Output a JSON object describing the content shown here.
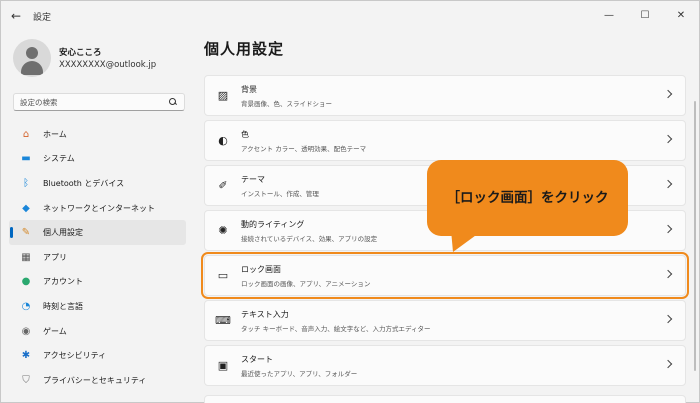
{
  "window": {
    "title": "設定",
    "back_glyph": "←",
    "minimize_glyph": "—",
    "maximize_glyph": "☐",
    "close_glyph": "✕"
  },
  "profile": {
    "name": "安心こころ",
    "email": "XXXXXXXX@outlook.jp"
  },
  "search": {
    "placeholder": "設定の検索"
  },
  "sidebar": {
    "items": [
      {
        "label": "ホーム",
        "icon": "home-icon",
        "glyph": "⌂",
        "color": "#d4622a"
      },
      {
        "label": "システム",
        "icon": "system-icon",
        "glyph": "▬",
        "color": "#1a86d9"
      },
      {
        "label": "Bluetooth とデバイス",
        "icon": "bluetooth-icon",
        "glyph": "ᛒ",
        "color": "#1a86d9"
      },
      {
        "label": "ネットワークとインターネット",
        "icon": "network-icon",
        "glyph": "◆",
        "color": "#1a86d9"
      },
      {
        "label": "個人用設定",
        "icon": "personalization-icon",
        "glyph": "✎",
        "color": "#d4892a"
      },
      {
        "label": "アプリ",
        "icon": "apps-icon",
        "glyph": "▦",
        "color": "#555555"
      },
      {
        "label": "アカウント",
        "icon": "account-icon",
        "glyph": "●",
        "color": "#2aa86f"
      },
      {
        "label": "時刻と言語",
        "icon": "time-language-icon",
        "glyph": "◔",
        "color": "#1a86d9"
      },
      {
        "label": "ゲーム",
        "icon": "gaming-icon",
        "glyph": "◉",
        "color": "#666666"
      },
      {
        "label": "アクセシビリティ",
        "icon": "accessibility-icon",
        "glyph": "✱",
        "color": "#1a6fc9"
      },
      {
        "label": "プライバシーとセキュリティ",
        "icon": "shield-icon",
        "glyph": "⛉",
        "color": "#777777"
      }
    ],
    "selected_index": 4,
    "accent": "#0067c0"
  },
  "main": {
    "title": "個人用設定",
    "cards": [
      {
        "title": "背景",
        "sub": "背景画像、色、スライドショー",
        "icon": "background-image-icon",
        "glyph": "▨"
      },
      {
        "title": "色",
        "sub": "アクセント カラー、透明効果、配色テーマ",
        "icon": "color-palette-icon",
        "glyph": "◐"
      },
      {
        "title": "テーマ",
        "sub": "インストール、作成、管理",
        "icon": "theme-brush-icon",
        "glyph": "✐"
      },
      {
        "title": "動的ライティング",
        "sub": "接続されているデバイス、効果、アプリの設定",
        "icon": "dynamic-lighting-icon",
        "glyph": "✺"
      },
      {
        "title": "ロック画面",
        "sub": "ロック画面の画像、アプリ、アニメーション",
        "icon": "lock-screen-icon",
        "glyph": "▭"
      },
      {
        "title": "テキスト入力",
        "sub": "タッチ キーボード、音声入力、絵文字など、入力方式エディター",
        "icon": "keyboard-icon",
        "glyph": "⌨"
      },
      {
        "title": "スタート",
        "sub": "最近使ったアプリ、アプリ、フォルダー",
        "icon": "start-icon",
        "glyph": "▣"
      }
    ],
    "highlighted_index": 4
  },
  "callout": {
    "text": "［ロック画面］をクリック",
    "color": "#f08a1c"
  }
}
